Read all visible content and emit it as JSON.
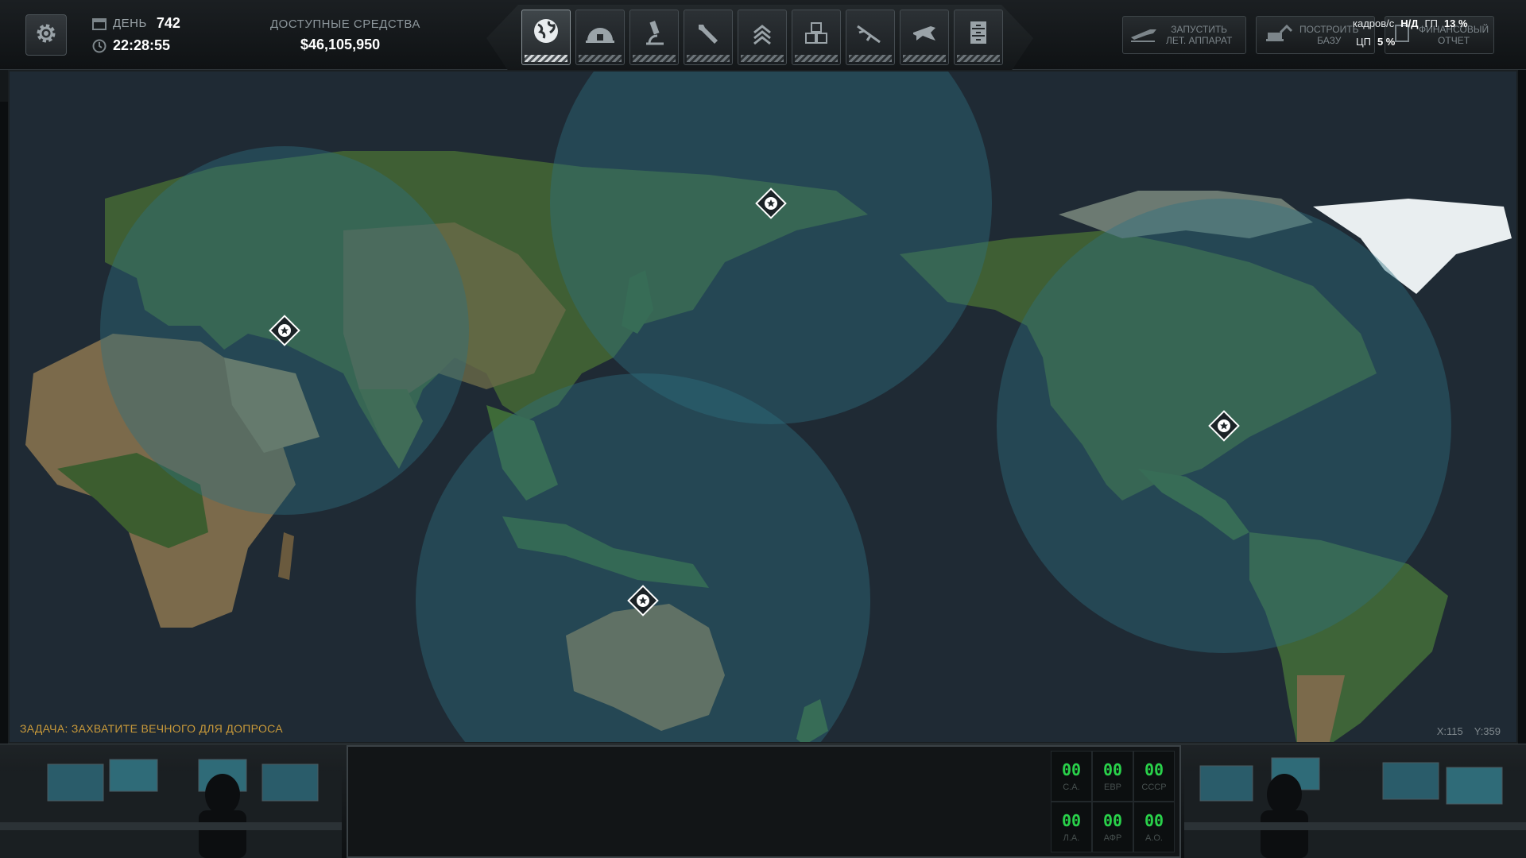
{
  "header": {
    "day_label": "ДЕНЬ",
    "day_value": "742",
    "clock": "22:28:55",
    "funds_label": "ДОСТУПНЫЕ СРЕДСТВА",
    "funds_value": "$46,105,950"
  },
  "menu": [
    {
      "name": "geoscape",
      "icon": "globe-icon",
      "active": true
    },
    {
      "name": "base",
      "icon": "dome-icon",
      "active": false
    },
    {
      "name": "research",
      "icon": "microscope-icon",
      "active": false
    },
    {
      "name": "engineering",
      "icon": "wrench-icon",
      "active": false
    },
    {
      "name": "barracks",
      "icon": "rank-chevron-icon",
      "active": false
    },
    {
      "name": "storage",
      "icon": "crates-icon",
      "active": false
    },
    {
      "name": "arsenal",
      "icon": "rifle-icon",
      "active": false
    },
    {
      "name": "hangar",
      "icon": "jet-icon",
      "active": false
    },
    {
      "name": "archive",
      "icon": "cabinet-icon",
      "active": false
    }
  ],
  "actions": {
    "launch_line1": "ЗАПУСТИТЬ",
    "launch_line2": "ЛЕТ. АППАРАТ",
    "build_line1": "ПОСТРОИТЬ",
    "build_line2": "БАЗУ",
    "report_line1": "ФИНАНСОВЫЙ",
    "report_line2": "ОТЧЕТ"
  },
  "stats": {
    "fps_label": "кадров/с",
    "fps_value": "Н/Д",
    "gpu_label": "ГП",
    "gpu_value": "13 %",
    "cpu_label": "ЦП",
    "cpu_value": "5 %"
  },
  "speed": [
    {
      "symbol": "›",
      "active": true
    },
    {
      "symbol": "»",
      "active": false
    },
    {
      "symbol": "⋙",
      "active": false
    },
    {
      "symbol": "»»",
      "active": false
    }
  ],
  "map": {
    "objective": "ЗАДАЧА: ЗАХВАТИТЕ ВЕЧНОГО ДЛЯ ДОПРОСА",
    "coord_x": "X:115",
    "coord_y": "Y:359",
    "bases": [
      {
        "name": "base-middle-east"
      },
      {
        "name": "base-kamchatka"
      },
      {
        "name": "base-central-america"
      },
      {
        "name": "base-australia"
      }
    ]
  },
  "panic": [
    {
      "value": "00",
      "region": "С.А."
    },
    {
      "value": "00",
      "region": "ЕВР"
    },
    {
      "value": "00",
      "region": "СССР"
    },
    {
      "value": "00",
      "region": "Л.А."
    },
    {
      "value": "00",
      "region": "АФР"
    },
    {
      "value": "00",
      "region": "А.О."
    }
  ],
  "colors": {
    "radar": "#2d5f70",
    "panic_green": "#29d14a",
    "objective": "#c99a3a"
  }
}
